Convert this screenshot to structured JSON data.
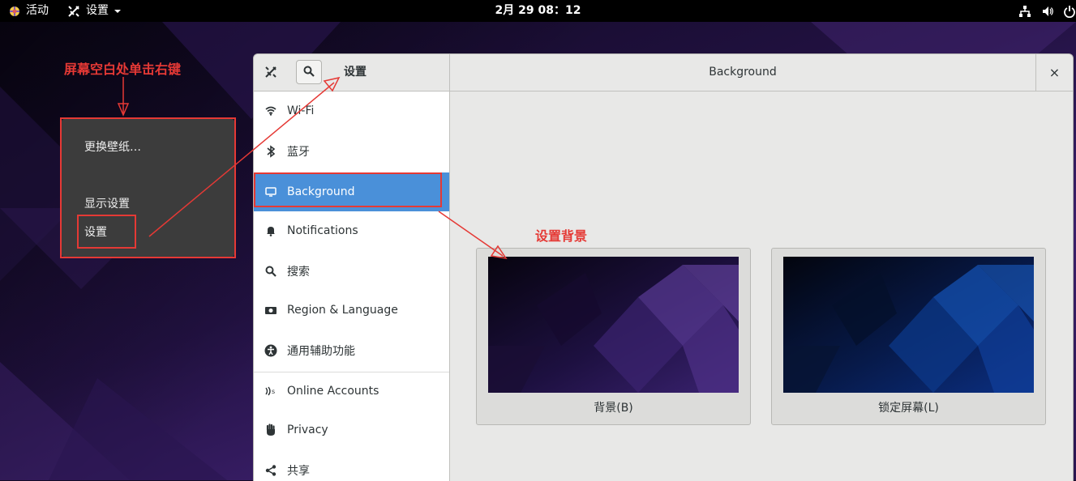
{
  "topbar": {
    "activities": "活动",
    "app_menu": "设置",
    "clock": "2月 29  08：12"
  },
  "context_menu": {
    "items": [
      "更换壁纸…",
      "显示设置",
      "设置"
    ]
  },
  "annotations": {
    "right_click_hint": "屏幕空白处单击右键",
    "set_background_hint": "设置背景"
  },
  "window": {
    "sidebar_title": "设置",
    "content_title": "Background",
    "close": "×"
  },
  "sidebar": {
    "items": [
      {
        "label": "Wi-Fi",
        "icon": "wifi-icon"
      },
      {
        "label": "蓝牙",
        "icon": "bluetooth-icon"
      },
      {
        "label": "Background",
        "icon": "display-icon",
        "active": true
      },
      {
        "label": "Notifications",
        "icon": "bell-icon"
      },
      {
        "label": "搜索",
        "icon": "search-icon"
      },
      {
        "label": "Region & Language",
        "icon": "camera-icon"
      },
      {
        "label": "通用辅助功能",
        "icon": "accessibility-icon"
      },
      {
        "label": "Online Accounts",
        "icon": "online-accounts-icon"
      },
      {
        "label": "Privacy",
        "icon": "hand-icon"
      },
      {
        "label": "共享",
        "icon": "share-icon"
      }
    ]
  },
  "backgrounds": {
    "desktop_label": "背景(B)",
    "lock_label": "锁定屏幕(L)"
  },
  "colors": {
    "accent": "#4a90d9",
    "annotation": "#e53935",
    "wallpaper_purple": "#3b1f6a",
    "wallpaper_blue": "#0a2a7a"
  }
}
